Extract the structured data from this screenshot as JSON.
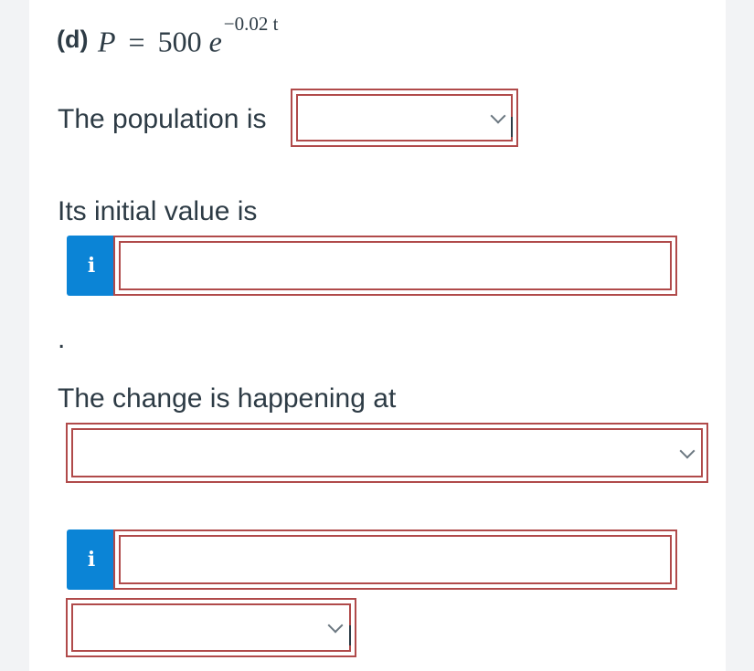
{
  "question": {
    "part_label": "(d)",
    "equation": {
      "var": "P",
      "eq": "=",
      "coef": "500",
      "base": "e",
      "exponent": "−0.02 t"
    }
  },
  "population_prompt": "The population is",
  "population_select": {
    "value": ""
  },
  "initial_prompt": "Its initial value is",
  "initial_input": {
    "info_icon": "i",
    "value": ""
  },
  "trailing_period": ".",
  "change_prompt": "The change is happening at",
  "change_select": {
    "value": ""
  },
  "rate_input": {
    "info_icon": "i",
    "value": ""
  },
  "rate_unit_select": {
    "value": ""
  },
  "colors": {
    "border": "#b04a4a",
    "info_button": "#0b84d6",
    "text": "#2d3b45"
  }
}
